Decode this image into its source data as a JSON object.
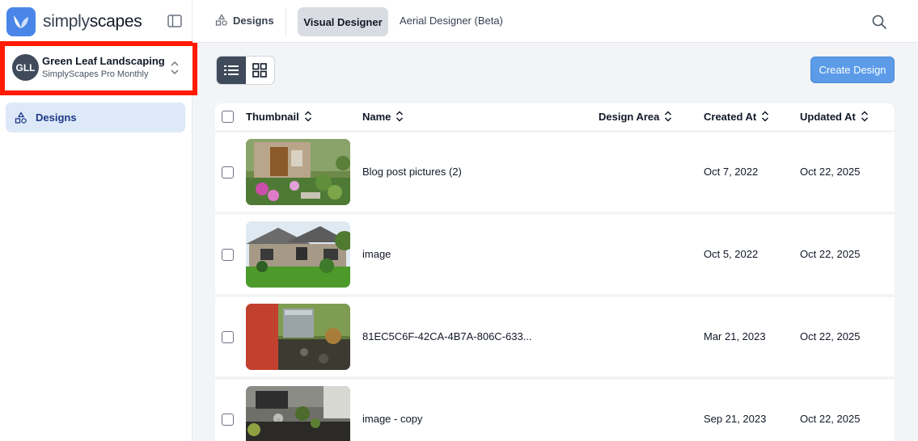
{
  "brand": {
    "name_part1": "simply",
    "name_part2": "scapes"
  },
  "org": {
    "initials": "GLL",
    "name": "Green Leaf Landscaping",
    "plan": "SimplyScapes Pro Monthly"
  },
  "sidebar": {
    "items": [
      {
        "label": "Designs",
        "icon": "designs-shapes-icon"
      }
    ]
  },
  "topbar": {
    "designs_label": "Designs",
    "tabs": [
      {
        "label": "Visual Designer",
        "active": true
      },
      {
        "label": "Aerial Designer (Beta)",
        "active": false
      }
    ]
  },
  "toolbar": {
    "create_label": "Create Design",
    "view_mode": "list"
  },
  "table": {
    "headers": {
      "thumbnail": "Thumbnail",
      "name": "Name",
      "design_area": "Design Area",
      "created_at": "Created At",
      "updated_at": "Updated At"
    },
    "rows": [
      {
        "name": "Blog post pictures (2)",
        "design_area": "",
        "created_at": "Oct 7, 2022",
        "updated_at": "Oct 22, 2025"
      },
      {
        "name": "image",
        "design_area": "",
        "created_at": "Oct 5, 2022",
        "updated_at": "Oct 22, 2025"
      },
      {
        "name": "81EC5C6F-42CA-4B7A-806C-633...",
        "design_area": "",
        "created_at": "Mar 21, 2023",
        "updated_at": "Oct 22, 2025"
      },
      {
        "name": "image - copy",
        "design_area": "",
        "created_at": "Sep 21, 2023",
        "updated_at": "Oct 22, 2025"
      }
    ]
  },
  "colors": {
    "accent": "#5b9be8",
    "brand": "#4a86e8",
    "highlight": "#ff1a00",
    "nav_active_bg": "#dde9f8",
    "avatar_bg": "#3f4a5a"
  }
}
